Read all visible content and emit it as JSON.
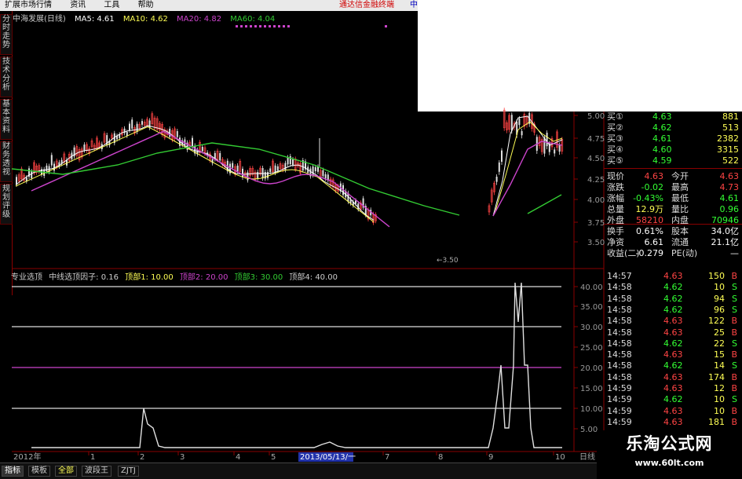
{
  "menu": {
    "items": [
      "扩展市场行情",
      "资讯",
      "工具",
      "帮助"
    ],
    "promo": "通达信金融终端",
    "promo2": "中"
  },
  "sidebar": {
    "tabs": [
      "分时走势",
      "技术分析",
      "基本资料",
      "财务透视",
      "规划评级"
    ]
  },
  "ma_header": {
    "stock": "中海发展(日线)",
    "items": [
      {
        "label": "MA5: 4.61",
        "color": "#ffffff"
      },
      {
        "label": "MA10: 4.62",
        "color": "#ffff55"
      },
      {
        "label": "MA20: 4.82",
        "color": "#cc44cc"
      },
      {
        "label": "MA60: 4.04",
        "color": "#33cc33"
      }
    ]
  },
  "price_axis": {
    "labels": [
      "5.00",
      "4.75",
      "4.50",
      "4.25",
      "4.00",
      "3.75",
      "3.50"
    ],
    "low_marker": "←3.50"
  },
  "indicator": {
    "name": "专业选顶",
    "factor": "中线选顶因子: 0.16",
    "tops": [
      {
        "label": "顶部1: 10.00",
        "color": "#ffff55"
      },
      {
        "label": "顶部2: 20.00",
        "color": "#cc44cc"
      },
      {
        "label": "顶部3: 30.00",
        "color": "#33cc33"
      },
      {
        "label": "顶部4: 40.00",
        "color": "#cccccc"
      }
    ],
    "axis_labels": [
      "40.00",
      "35.00",
      "30.00",
      "25.00",
      "20.00",
      "15.00",
      "10.00",
      "5.00"
    ]
  },
  "time_axis": {
    "year": "2012年",
    "months": [
      "1",
      "2",
      "3",
      "4",
      "5",
      "6",
      "7",
      "8",
      "9",
      "10"
    ],
    "cursor_date": "2013/05/13/一",
    "right_label": "日线"
  },
  "quote": {
    "bids": [
      {
        "label": "买①",
        "price": "4.63",
        "vol": "881"
      },
      {
        "label": "买②",
        "price": "4.62",
        "vol": "513"
      },
      {
        "label": "买③",
        "price": "4.61",
        "vol": "2382"
      },
      {
        "label": "买④",
        "price": "4.60",
        "vol": "3315"
      },
      {
        "label": "买⑤",
        "price": "4.59",
        "vol": "522"
      }
    ],
    "stats": [
      {
        "l1": "现价",
        "v1": "4.63",
        "c1": "#ff4444",
        "l2": "今开",
        "v2": "4.63",
        "c2": "#ff4444"
      },
      {
        "l1": "涨跌",
        "v1": "-0.02",
        "c1": "#33ff33",
        "l2": "最高",
        "v2": "4.73",
        "c2": "#ff4444"
      },
      {
        "l1": "涨幅",
        "v1": "-0.43%",
        "c1": "#33ff33",
        "l2": "最低",
        "v2": "4.61",
        "c2": "#33ff33"
      },
      {
        "l1": "总量",
        "v1": "12.9万",
        "c1": "#ffff55",
        "l2": "量比",
        "v2": "0.96",
        "c2": "#33ff33"
      },
      {
        "l1": "外盘",
        "v1": "58210",
        "c1": "#ff4444",
        "l2": "内盘",
        "v2": "70946",
        "c2": "#33ff33"
      },
      {
        "l1": "换手",
        "v1": "0.61%",
        "c1": "#ffffff",
        "l2": "股本",
        "v2": "34.0亿",
        "c2": "#ffffff"
      },
      {
        "l1": "净资",
        "v1": "6.61",
        "c1": "#ffffff",
        "l2": "流通",
        "v2": "21.1亿",
        "c2": "#ffffff"
      },
      {
        "l1": "收益(二)",
        "v1": "-0.279",
        "c1": "#ffffff",
        "l2": "PE(动)",
        "v2": "—",
        "c2": "#ffffff"
      }
    ]
  },
  "ticks": [
    {
      "time": "14:57",
      "price": "4.63",
      "vol": "150",
      "side": "B"
    },
    {
      "time": "14:58",
      "price": "4.62",
      "vol": "10",
      "side": "S"
    },
    {
      "time": "14:58",
      "price": "4.62",
      "vol": "94",
      "side": "S"
    },
    {
      "time": "14:58",
      "price": "4.62",
      "vol": "96",
      "side": "S"
    },
    {
      "time": "14:58",
      "price": "4.63",
      "vol": "122",
      "side": "B"
    },
    {
      "time": "14:58",
      "price": "4.63",
      "vol": "25",
      "side": "B"
    },
    {
      "time": "14:58",
      "price": "4.62",
      "vol": "22",
      "side": "S"
    },
    {
      "time": "14:58",
      "price": "4.63",
      "vol": "15",
      "side": "B"
    },
    {
      "time": "14:58",
      "price": "4.62",
      "vol": "14",
      "side": "S"
    },
    {
      "time": "14:58",
      "price": "4.63",
      "vol": "174",
      "side": "B"
    },
    {
      "time": "14:59",
      "price": "4.63",
      "vol": "12",
      "side": "B"
    },
    {
      "time": "14:59",
      "price": "4.62",
      "vol": "10",
      "side": "S"
    },
    {
      "time": "14:59",
      "price": "4.63",
      "vol": "10",
      "side": "B"
    },
    {
      "time": "14:59",
      "price": "4.63",
      "vol": "181",
      "side": "B"
    }
  ],
  "bottombar": {
    "tabs": [
      "指标",
      "模板",
      "全部",
      "波段王",
      "ZJTJ"
    ]
  },
  "watermark": {
    "title": "乐淘公式网",
    "url": "www.60lt.com"
  },
  "colors": {
    "up": "#ff4444",
    "down": "#33ff33",
    "border": "#8a0000",
    "grid": "#8a0000"
  }
}
